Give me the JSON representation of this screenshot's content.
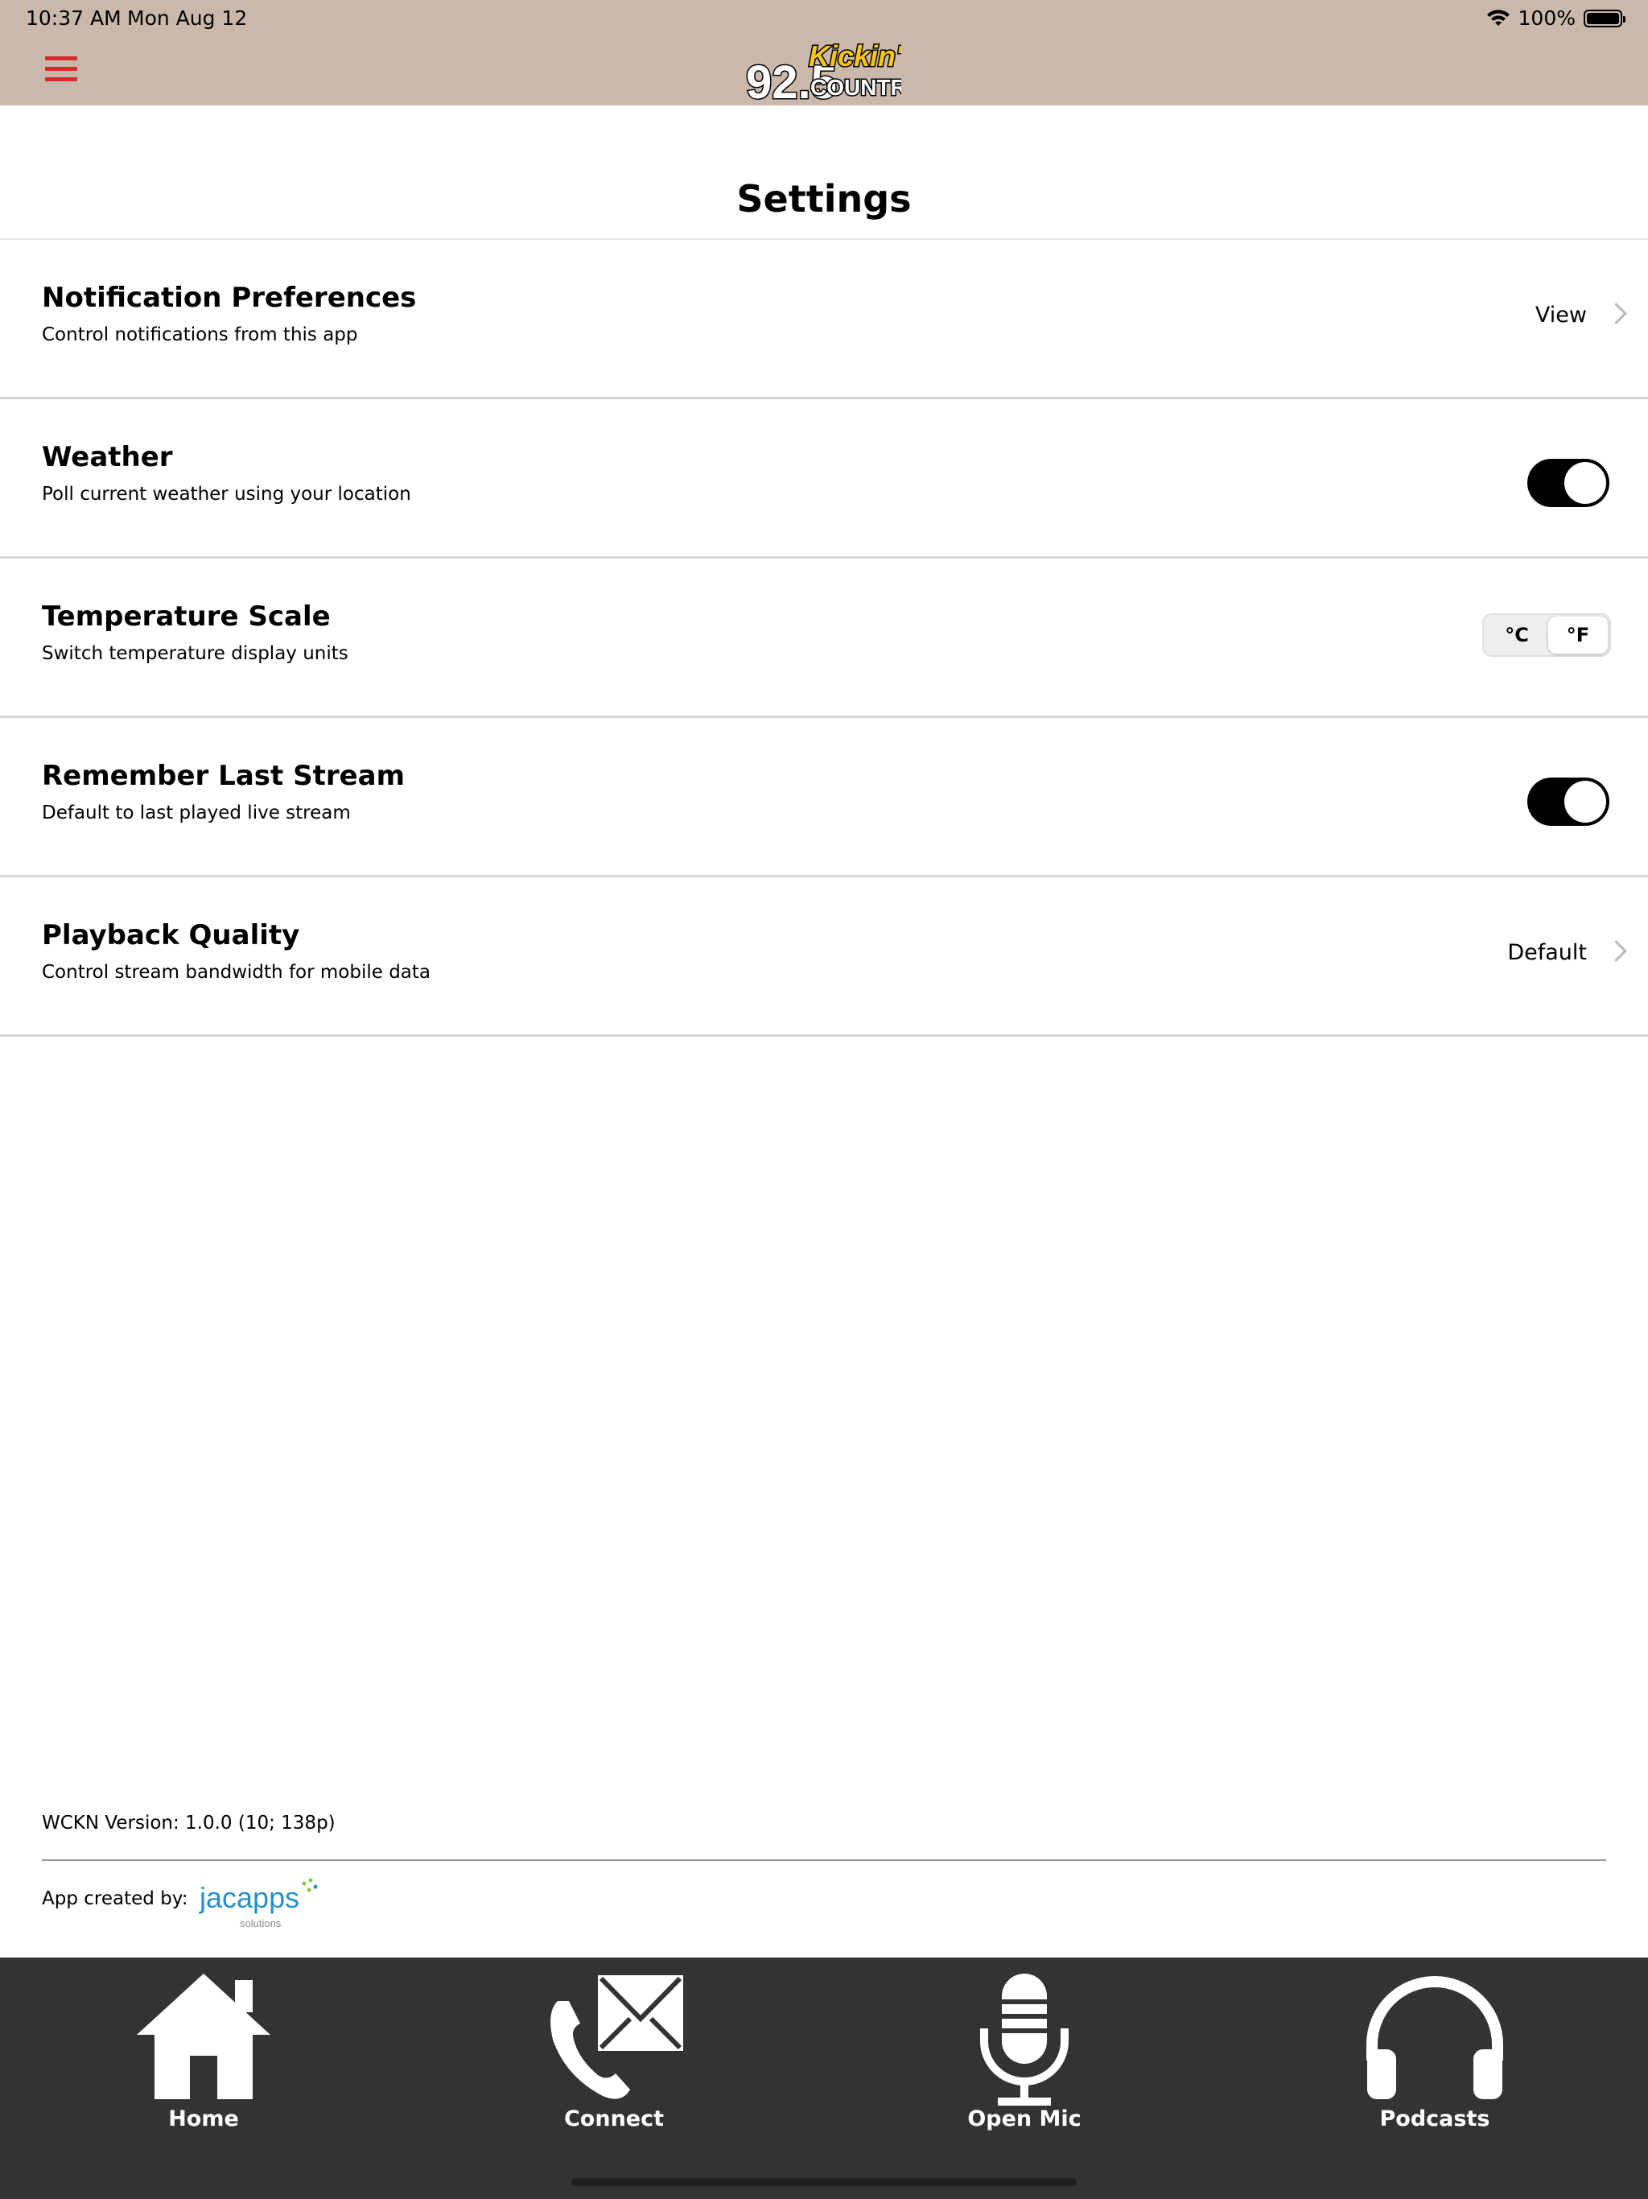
{
  "status_bar": {
    "time": "10:37 AM",
    "date": "Mon Aug 12",
    "battery": "100%"
  },
  "header": {
    "logo": {
      "number": "92.5",
      "word1": "Kickin'",
      "word2": "COUNTRY"
    }
  },
  "page": {
    "title": "Settings"
  },
  "settings": [
    {
      "title": "Notification Preferences",
      "subtitle": "Control notifications from this app",
      "value": "View"
    },
    {
      "title": "Weather",
      "subtitle": "Poll current weather using your location",
      "enabled": true
    },
    {
      "title": "Temperature Scale",
      "subtitle": "Switch temperature display units",
      "options": [
        "°C",
        "°F"
      ],
      "selected": "°F"
    },
    {
      "title": "Remember Last Stream",
      "subtitle": "Default to last played live stream",
      "enabled": true
    },
    {
      "title": "Playback Quality",
      "subtitle": "Control stream bandwidth for mobile data",
      "value": "Default"
    }
  ],
  "footer": {
    "version": "WCKN Version: 1.0.0 (10; 138p)",
    "created_by_label": "App created by:",
    "creator_logo": {
      "main": "jacapps",
      "sub": "solutions"
    }
  },
  "tabs": [
    {
      "label": "Home",
      "icon": "home-icon"
    },
    {
      "label": "Connect",
      "icon": "phone-mail-icon"
    },
    {
      "label": "Open Mic",
      "icon": "microphone-icon"
    },
    {
      "label": "Podcasts",
      "icon": "headphones-icon"
    }
  ],
  "colors": {
    "header_bg": "#cab8ab",
    "menu_icon": "#d62c2c",
    "tab_bar_bg": "#333333",
    "logo_yellow": "#f5c518"
  }
}
